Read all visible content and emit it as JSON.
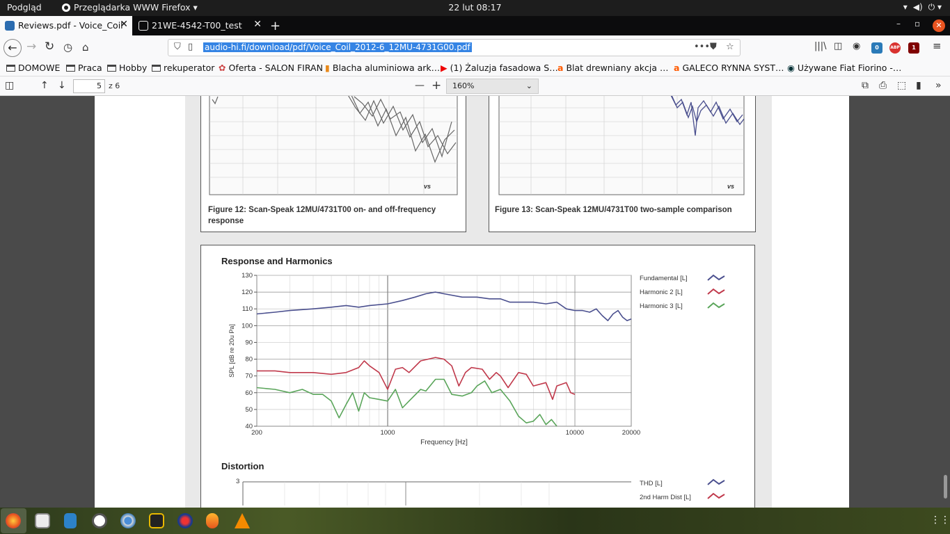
{
  "topbar": {
    "activities": "Podgląd",
    "app_name": "Przeglądarka WWW Firefox ▾",
    "clock": "22 lut  08:17"
  },
  "tabs": [
    {
      "title": "Reviews.pdf - Voice_Coil",
      "active": true
    },
    {
      "title": "21WE-4542-T00_test",
      "active": false
    }
  ],
  "nav": {
    "url": "audio-hi.fi/download/pdf/Voice_Coil_2012-6_12MU-4731G00.pdf",
    "badge_mail": "0",
    "badge_abp": "ABP",
    "badge_ublock": "1"
  },
  "bookmarks": [
    {
      "label": "DOMOWE",
      "icon": "folder-icon"
    },
    {
      "label": "Praca",
      "icon": "folder-icon"
    },
    {
      "label": "Hobby",
      "icon": "folder-icon"
    },
    {
      "label": "rekuperator",
      "icon": "folder-icon"
    },
    {
      "label": "Oferta - SALON FIRAN",
      "icon": "site-icon"
    },
    {
      "label": "Blacha aluminiowa ark…",
      "icon": "chart-site-icon"
    },
    {
      "label": "(1) Żaluzja fasadowa S…",
      "icon": "youtube-icon"
    },
    {
      "label": "Blat drewniany akcja …",
      "icon": "allegro-icon"
    },
    {
      "label": "GALECO RYNNA SYST…",
      "icon": "allegro-icon"
    },
    {
      "label": "Używane Fiat Fiorino -…",
      "icon": "olx-icon"
    }
  ],
  "pdf": {
    "page_number": "5",
    "page_count": "z 6",
    "zoom": "160%"
  },
  "figures": {
    "fig12_caption": "Figure 12: Scan-Speak 12MU/4731T00 on- and off-frequency response",
    "fig13_caption": "Figure 13: Scan-Speak 12MU/4731T00 two-sample comparison",
    "fig12_tag": "vs",
    "fig13_tag": "vs",
    "distortion_title": "Distortion",
    "distortion_ytick": "3",
    "distortion_legend": [
      "THD [L]",
      "2nd Harm Dist [L]"
    ]
  },
  "chart_data": {
    "type": "line",
    "title": "Response and Harmonics",
    "xlabel": "Frequency [Hz]",
    "ylabel": "SPL [dB re 20u Pa]",
    "x_scale": "log",
    "xlim": [
      200,
      20000
    ],
    "ylim": [
      40,
      130
    ],
    "xticks": [
      200,
      1000,
      10000,
      20000
    ],
    "yticks": [
      40,
      50,
      60,
      70,
      80,
      90,
      100,
      110,
      120,
      130
    ],
    "grid": true,
    "legend_position": "right",
    "series": [
      {
        "name": "Fundamental [L]",
        "color": "#4a4f8e",
        "points": [
          [
            200,
            107
          ],
          [
            250,
            108
          ],
          [
            300,
            109
          ],
          [
            400,
            110
          ],
          [
            500,
            111
          ],
          [
            600,
            112
          ],
          [
            700,
            111
          ],
          [
            800,
            112
          ],
          [
            1000,
            113
          ],
          [
            1200,
            115
          ],
          [
            1400,
            117
          ],
          [
            1600,
            119
          ],
          [
            1800,
            120
          ],
          [
            2000,
            119
          ],
          [
            2500,
            117
          ],
          [
            3000,
            117
          ],
          [
            3500,
            116
          ],
          [
            4000,
            116
          ],
          [
            4500,
            114
          ],
          [
            5000,
            114
          ],
          [
            6000,
            114
          ],
          [
            7000,
            113
          ],
          [
            8000,
            114
          ],
          [
            9000,
            110
          ],
          [
            10000,
            109
          ],
          [
            11000,
            109
          ],
          [
            12000,
            108
          ],
          [
            13000,
            110
          ],
          [
            14000,
            106
          ],
          [
            15000,
            103
          ],
          [
            16000,
            107
          ],
          [
            17000,
            109
          ],
          [
            18000,
            105
          ],
          [
            19000,
            103
          ],
          [
            20000,
            104
          ]
        ]
      },
      {
        "name": "Harmonic 2 [L]",
        "color": "#c0394b",
        "points": [
          [
            200,
            73
          ],
          [
            250,
            73
          ],
          [
            300,
            72
          ],
          [
            400,
            72
          ],
          [
            500,
            71
          ],
          [
            600,
            72
          ],
          [
            700,
            75
          ],
          [
            750,
            79
          ],
          [
            800,
            76
          ],
          [
            900,
            72
          ],
          [
            1000,
            62
          ],
          [
            1100,
            74
          ],
          [
            1200,
            75
          ],
          [
            1300,
            72
          ],
          [
            1500,
            79
          ],
          [
            1800,
            81
          ],
          [
            2000,
            80
          ],
          [
            2200,
            76
          ],
          [
            2400,
            64
          ],
          [
            2600,
            72
          ],
          [
            2800,
            75
          ],
          [
            3200,
            74
          ],
          [
            3500,
            68
          ],
          [
            3800,
            72
          ],
          [
            4000,
            70
          ],
          [
            4400,
            63
          ],
          [
            5000,
            72
          ],
          [
            5500,
            71
          ],
          [
            6000,
            64
          ],
          [
            7000,
            66
          ],
          [
            7600,
            56
          ],
          [
            8000,
            64
          ],
          [
            9000,
            66
          ],
          [
            9500,
            60
          ],
          [
            10000,
            59
          ]
        ]
      },
      {
        "name": "Harmonic 3 [L]",
        "color": "#5aa55a",
        "points": [
          [
            200,
            63
          ],
          [
            250,
            62
          ],
          [
            300,
            60
          ],
          [
            350,
            62
          ],
          [
            400,
            59
          ],
          [
            450,
            59
          ],
          [
            500,
            55
          ],
          [
            550,
            45
          ],
          [
            600,
            53
          ],
          [
            650,
            60
          ],
          [
            700,
            49
          ],
          [
            750,
            60
          ],
          [
            800,
            57
          ],
          [
            900,
            56
          ],
          [
            1000,
            55
          ],
          [
            1100,
            62
          ],
          [
            1200,
            51
          ],
          [
            1300,
            55
          ],
          [
            1500,
            62
          ],
          [
            1600,
            61
          ],
          [
            1800,
            68
          ],
          [
            2000,
            68
          ],
          [
            2200,
            59
          ],
          [
            2500,
            58
          ],
          [
            2800,
            60
          ],
          [
            3000,
            64
          ],
          [
            3300,
            67
          ],
          [
            3600,
            60
          ],
          [
            4000,
            62
          ],
          [
            4500,
            55
          ],
          [
            5000,
            46
          ],
          [
            5500,
            42
          ],
          [
            6000,
            43
          ],
          [
            6500,
            47
          ],
          [
            7000,
            41
          ],
          [
            7500,
            44
          ],
          [
            8000,
            40
          ]
        ]
      }
    ]
  },
  "dock": [
    "firefox-icon",
    "files-icon",
    "writer-icon",
    "software-icon",
    "chromium-icon",
    "rhythmbox-icon",
    "steam-icon",
    "flame-icon",
    "vlc-icon"
  ],
  "tray": [
    "wifi-icon",
    "volume-icon",
    "power-icon"
  ]
}
